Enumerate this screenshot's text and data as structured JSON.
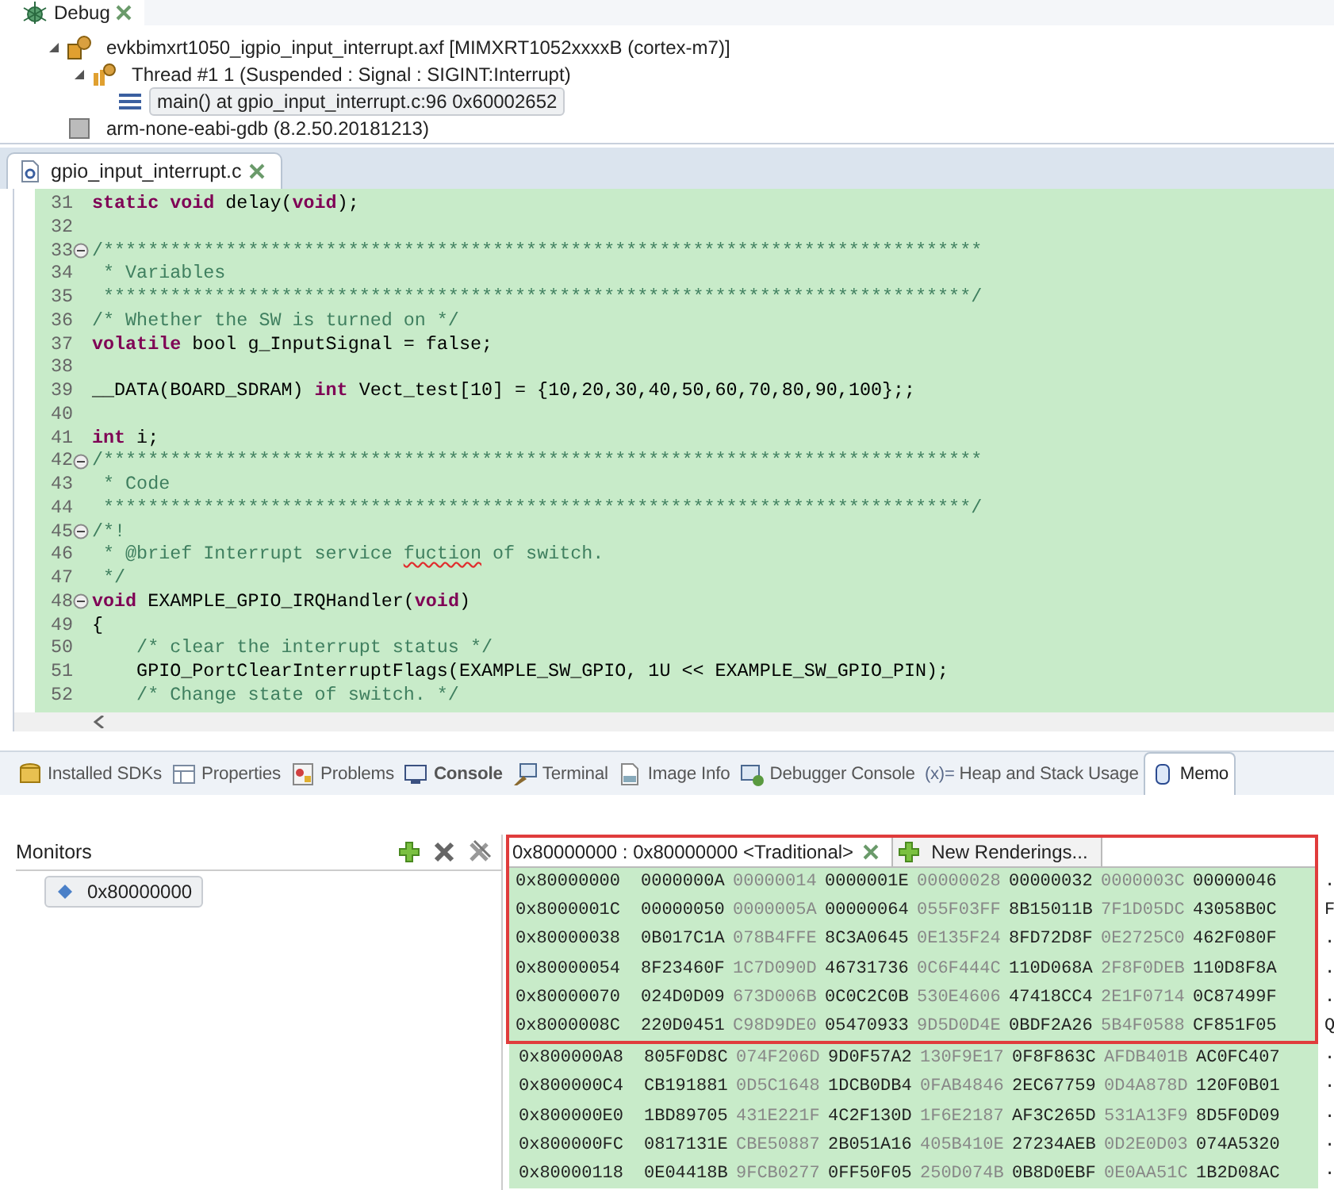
{
  "debug": {
    "tab_title": "Debug",
    "tree": [
      {
        "kind": "process",
        "label": "evkbimxrt1050_igpio_input_interrupt.axf [MIMXRT1052xxxxB (cortex-m7)]",
        "expanded": true,
        "selected": false,
        "children": [
          {
            "kind": "thread",
            "label": "Thread #1 1 (Suspended : Signal : SIGINT:Interrupt)",
            "expanded": true,
            "selected": false,
            "children": [
              {
                "kind": "frame",
                "label": "main() at gpio_input_interrupt.c:96 0x60002652",
                "selected": true
              }
            ]
          }
        ]
      },
      {
        "kind": "gdb",
        "label": "arm-none-eabi-gdb (8.2.50.20181213)",
        "selected": false
      }
    ]
  },
  "editor": {
    "tab_title": "gpio_input_interrupt.c",
    "lines": [
      {
        "number": "31",
        "fold": false,
        "tokens": [
          {
            "kind": "keyword",
            "text": "static void"
          },
          {
            "kind": "plain",
            "text": " delay("
          },
          {
            "kind": "keyword",
            "text": "void"
          },
          {
            "kind": "plain",
            "text": ");"
          }
        ]
      },
      {
        "number": "32",
        "fold": false
      },
      {
        "number": "33",
        "fold": true,
        "tokens": [
          {
            "kind": "comment",
            "text": "/*******************************************************************************"
          }
        ]
      },
      {
        "number": "34",
        "fold": false,
        "tokens": [
          {
            "kind": "comment",
            "text": " * Variables"
          }
        ]
      },
      {
        "number": "35",
        "fold": false,
        "tokens": [
          {
            "kind": "comment",
            "text": " ******************************************************************************/"
          }
        ]
      },
      {
        "number": "36",
        "fold": false,
        "tokens": [
          {
            "kind": "comment",
            "text": "/* Whether the SW is turned on */"
          }
        ]
      },
      {
        "number": "37",
        "fold": false,
        "tokens": [
          {
            "kind": "keyword",
            "text": "volatile"
          },
          {
            "kind": "plain",
            "text": " bool g_InputSignal = false;"
          }
        ]
      },
      {
        "number": "38",
        "fold": false
      },
      {
        "number": "39",
        "fold": false,
        "tokens": [
          {
            "kind": "plain",
            "text": "__DATA(BOARD_SDRAM) "
          },
          {
            "kind": "keyword",
            "text": "int"
          },
          {
            "kind": "plain",
            "text": " Vect_test[10] = {10,20,30,40,50,60,70,80,90,100};;"
          }
        ]
      },
      {
        "number": "40",
        "fold": false
      },
      {
        "number": "41",
        "fold": false,
        "tokens": [
          {
            "kind": "keyword",
            "text": "int"
          },
          {
            "kind": "plain",
            "text": " i;"
          }
        ]
      },
      {
        "number": "42",
        "fold": true,
        "tokens": [
          {
            "kind": "comment",
            "text": "/*******************************************************************************"
          }
        ]
      },
      {
        "number": "43",
        "fold": false,
        "tokens": [
          {
            "kind": "comment",
            "text": " * Code"
          }
        ]
      },
      {
        "number": "44",
        "fold": false,
        "tokens": [
          {
            "kind": "comment",
            "text": " ******************************************************************************/"
          }
        ]
      },
      {
        "number": "45",
        "fold": true,
        "tokens": [
          {
            "kind": "comment",
            "text": "/*!"
          }
        ]
      },
      {
        "number": "46",
        "fold": false,
        "tokens": [
          {
            "kind": "comment",
            "text": " * @brief Interrupt service "
          },
          {
            "kind": "misspelled",
            "text": "fuction"
          },
          {
            "kind": "comment",
            "text": " of switch."
          }
        ]
      },
      {
        "number": "47",
        "fold": false,
        "tokens": [
          {
            "kind": "comment",
            "text": " */"
          }
        ]
      },
      {
        "number": "48",
        "fold": true,
        "tokens": [
          {
            "kind": "keyword",
            "text": "void"
          },
          {
            "kind": "plain",
            "text": " EXAMPLE_GPIO_IRQHandler("
          },
          {
            "kind": "keyword",
            "text": "void"
          },
          {
            "kind": "plain",
            "text": ")"
          }
        ]
      },
      {
        "number": "49",
        "fold": false,
        "tokens": [
          {
            "kind": "plain",
            "text": "{"
          }
        ]
      },
      {
        "number": "50",
        "fold": false,
        "tokens": [
          {
            "kind": "comment",
            "text": "    /* clear the interrupt status */"
          }
        ]
      },
      {
        "number": "51",
        "fold": false,
        "tokens": [
          {
            "kind": "plain",
            "text": "    GPIO_PortClearInterruptFlags(EXAMPLE_SW_GPIO, 1U << EXAMPLE_SW_GPIO_PIN);"
          }
        ]
      },
      {
        "number": "52",
        "fold": false,
        "tokens": [
          {
            "kind": "comment",
            "text": "    /* Change state of switch. */"
          }
        ]
      }
    ]
  },
  "bottom_tabs": [
    {
      "kind": "sdks",
      "label": "Installed SDKs",
      "selected": false,
      "emphasized": false
    },
    {
      "kind": "properties",
      "label": "Properties",
      "selected": false,
      "emphasized": false
    },
    {
      "kind": "problems",
      "label": "Problems",
      "selected": false,
      "emphasized": false
    },
    {
      "kind": "console",
      "label": "Console",
      "selected": false,
      "emphasized": true
    },
    {
      "kind": "terminal",
      "label": "Terminal",
      "selected": false,
      "emphasized": false
    },
    {
      "kind": "image",
      "label": "Image Info",
      "selected": false,
      "emphasized": false
    },
    {
      "kind": "debugger",
      "label": "Debugger Console",
      "selected": false,
      "emphasized": false
    },
    {
      "kind": "heap",
      "icon_text": "(x)=",
      "label": "Heap and Stack Usage",
      "selected": false,
      "emphasized": false
    },
    {
      "kind": "memory",
      "label": "Memo",
      "selected": true,
      "emphasized": false
    }
  ],
  "monitors": {
    "title": "Monitors",
    "items": [
      {
        "label": "0x80000000",
        "selected": true
      }
    ]
  },
  "rendering_tabs": [
    {
      "kind": "rendering",
      "label": "0x80000000 : 0x80000000 <Traditional>",
      "selected": true
    },
    {
      "kind": "new",
      "label": "New Renderings...",
      "selected": false
    }
  ],
  "highlighted_rows": [
    {
      "address": "0x80000000",
      "words": [
        "0000000A",
        "00000014",
        "0000001E",
        "00000028",
        "00000032",
        "0000003C",
        "00000046"
      ],
      "ascii": "."
    },
    {
      "address": "0x8000001C",
      "words": [
        "00000050",
        "0000005A",
        "00000064",
        "055F03FF",
        "8B15011B",
        "7F1D05DC",
        "43058B0C"
      ],
      "ascii": "F"
    },
    {
      "address": "0x80000038",
      "words": [
        "0B017C1A",
        "078B4FFE",
        "8C3A0645",
        "0E135F24",
        "8FD72D8F",
        "0E2725C0",
        "462F080F"
      ],
      "ascii": "."
    },
    {
      "address": "0x80000054",
      "words": [
        "8F23460F",
        "1C7D090D",
        "46731736",
        "0C6F444C",
        "110D068A",
        "2F8F0DEB",
        "110D8F8A"
      ],
      "ascii": "."
    },
    {
      "address": "0x80000070",
      "words": [
        "024D0D09",
        "673D006B",
        "0C0C2C0B",
        "530E4606",
        "47418CC4",
        "2E1F0714",
        "0C87499F"
      ],
      "ascii": "."
    },
    {
      "address": "0x8000008C",
      "words": [
        "220D0451",
        "C98D9DE0",
        "05470933",
        "9D5D0D4E",
        "0BDF2A26",
        "5B4F0588",
        "CF851F05"
      ],
      "ascii": "Q"
    }
  ],
  "memory_rows": [
    {
      "address": "0x800000A8",
      "words": [
        "805F0D8C",
        "074F206D",
        "9D0F57A2",
        "130F9E17",
        "0F8F863C",
        "AFDB401B",
        "AC0FC407"
      ],
      "ascii": "."
    },
    {
      "address": "0x800000C4",
      "words": [
        "CB191881",
        "0D5C1648",
        "1DCB0DB4",
        "0FAB4846",
        "2EC67759",
        "0D4A878D",
        "120F0B01"
      ],
      "ascii": "."
    },
    {
      "address": "0x800000E0",
      "words": [
        "1BD89705",
        "431E221F",
        "4C2F130D",
        "1F6E2187",
        "AF3C265D",
        "531A13F9",
        "8D5F0D09"
      ],
      "ascii": "."
    },
    {
      "address": "0x800000FC",
      "words": [
        "0817131E",
        "CBE50887",
        "2B051A16",
        "405B410E",
        "27234AEB",
        "0D2E0D03",
        "074A5320"
      ],
      "ascii": "."
    },
    {
      "address": "0x80000118",
      "words": [
        "0E04418B",
        "9FCB0277",
        "0FF50F05",
        "250D074B",
        "0B8D0EBF",
        "0E0AA51C",
        "1B2D08AC"
      ],
      "ascii": "."
    }
  ]
}
